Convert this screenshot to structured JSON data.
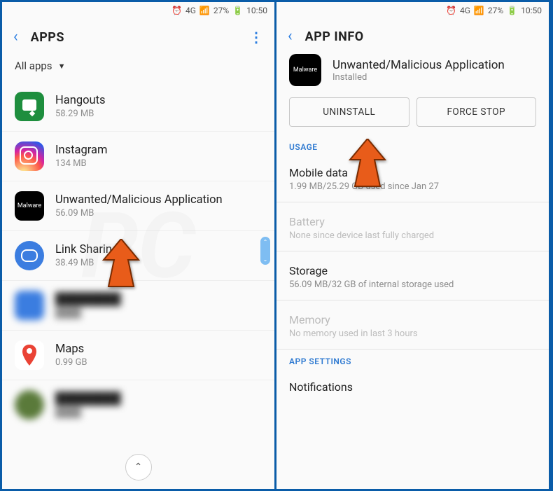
{
  "status": {
    "network": "4G",
    "battery": "27%",
    "time": "10:50"
  },
  "left": {
    "title": "APPS",
    "filter": "All apps",
    "apps": [
      {
        "name": "Hangouts",
        "size": "58.29 MB"
      },
      {
        "name": "Instagram",
        "size": "134 MB"
      },
      {
        "name": "Unwanted/Malicious Application",
        "size": "56.09 MB"
      },
      {
        "name": "Link Sharing",
        "size": "38.49 MB"
      },
      {
        "name": "",
        "size": ""
      },
      {
        "name": "Maps",
        "size": "0.99 GB"
      },
      {
        "name": "",
        "size": ""
      }
    ]
  },
  "right": {
    "title": "APP INFO",
    "app_name": "Unwanted/Malicious Application",
    "app_icon_label": "Malware",
    "app_status": "Installed",
    "buttons": {
      "uninstall": "UNINSTALL",
      "forcestop": "FORCE STOP"
    },
    "sections": {
      "usage_label": "USAGE",
      "mobile_data": {
        "title": "Mobile data",
        "sub": "1.99 MB/25.29 GB used since Jan 27"
      },
      "battery": {
        "title": "Battery",
        "sub": "None since device last fully charged"
      },
      "storage": {
        "title": "Storage",
        "sub": "56.09 MB/32 GB of internal storage used"
      },
      "memory": {
        "title": "Memory",
        "sub": "No memory used in last 3 hours"
      },
      "appsettings_label": "APP SETTINGS",
      "notifications": {
        "title": "Notifications"
      }
    }
  },
  "icon_labels": {
    "malware": "Malware"
  }
}
